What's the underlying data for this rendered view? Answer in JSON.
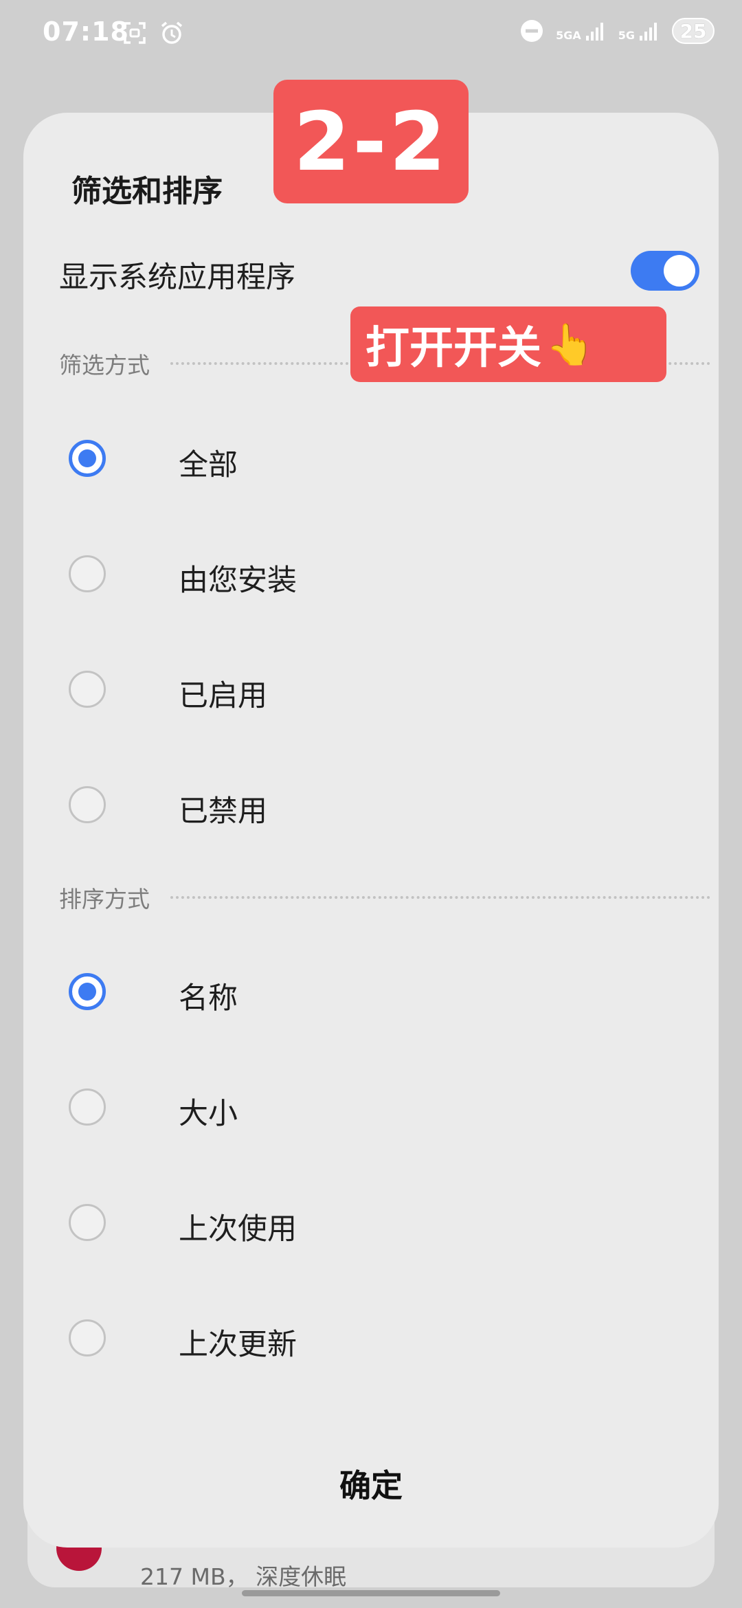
{
  "status_bar": {
    "time": "07:18",
    "left_icons": [
      "screenshot-icon",
      "alarm-icon"
    ],
    "net1": "5GA",
    "net2": "5G",
    "battery": "25",
    "right_icons": [
      "do-not-disturb-icon",
      "signal-icon",
      "signal-icon"
    ]
  },
  "background": {
    "app_subtitle": "217 MB， 深度休眠"
  },
  "sheet": {
    "title": "筛选和排序",
    "toggle": {
      "label": "显示系统应用程序",
      "on": true
    },
    "filter": {
      "header": "筛选方式",
      "options": [
        {
          "label": "全部",
          "checked": true
        },
        {
          "label": "由您安装",
          "checked": false
        },
        {
          "label": "已启用",
          "checked": false
        },
        {
          "label": "已禁用",
          "checked": false
        }
      ]
    },
    "sort": {
      "header": "排序方式",
      "options": [
        {
          "label": "名称",
          "checked": true
        },
        {
          "label": "大小",
          "checked": false
        },
        {
          "label": "上次使用",
          "checked": false
        },
        {
          "label": "上次更新",
          "checked": false
        }
      ]
    },
    "confirm_label": "确定"
  },
  "overlay": {
    "step": "2-2",
    "hint": "打开开关",
    "hint_icon": "pointing-hand-icon"
  },
  "colors": {
    "accent": "#3d7bf2",
    "badge": "#f25757"
  }
}
